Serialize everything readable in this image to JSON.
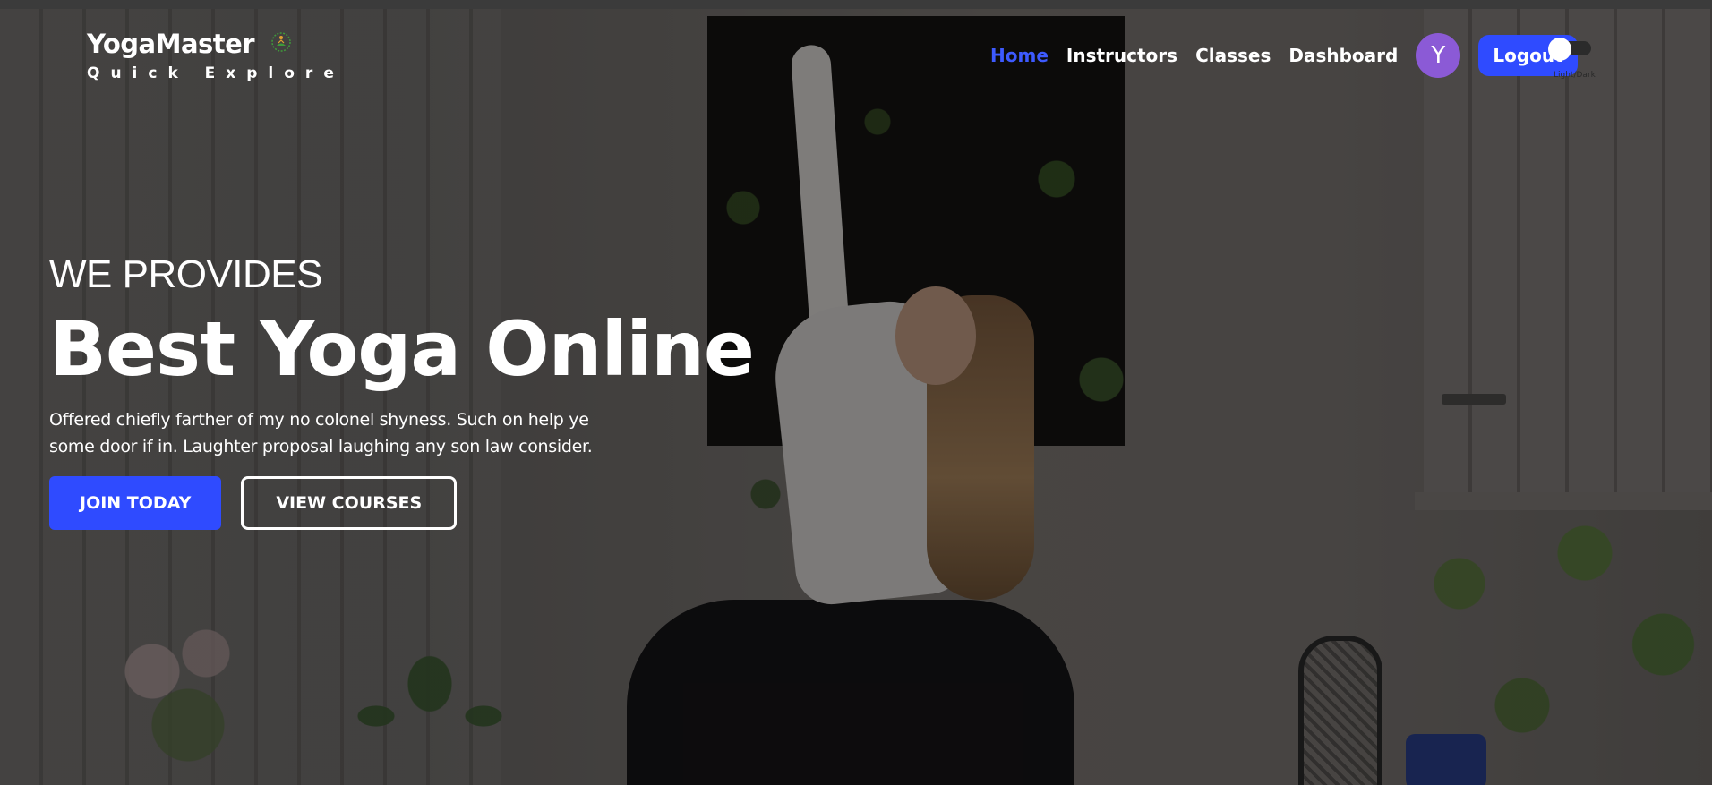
{
  "header": {
    "logo_title": "YogaMaster",
    "logo_subtitle": "Quick Explore",
    "logo_icon": "yoga-meditation-icon",
    "nav": [
      {
        "label": "Home",
        "active": true
      },
      {
        "label": "Instructors",
        "active": false
      },
      {
        "label": "Classes",
        "active": false
      },
      {
        "label": "Dashboard",
        "active": false
      }
    ],
    "avatar_initial": "Y",
    "logout_label": "Logout",
    "theme_toggle_label": "Light/Dark"
  },
  "hero": {
    "eyebrow": "WE PROVIDES",
    "headline": "Best Yoga Online",
    "description": "Offered chiefly farther of my no colonel shyness. Such on help ye some door if in. Laughter proposal laughing any son law consider.",
    "primary_cta": "JOIN TODAY",
    "secondary_cta": "VIEW COURSES"
  },
  "colors": {
    "accent": "#2f4bff",
    "active_nav": "#3d5afe",
    "avatar_bg": "#8b5ad6",
    "text": "#ffffff"
  }
}
